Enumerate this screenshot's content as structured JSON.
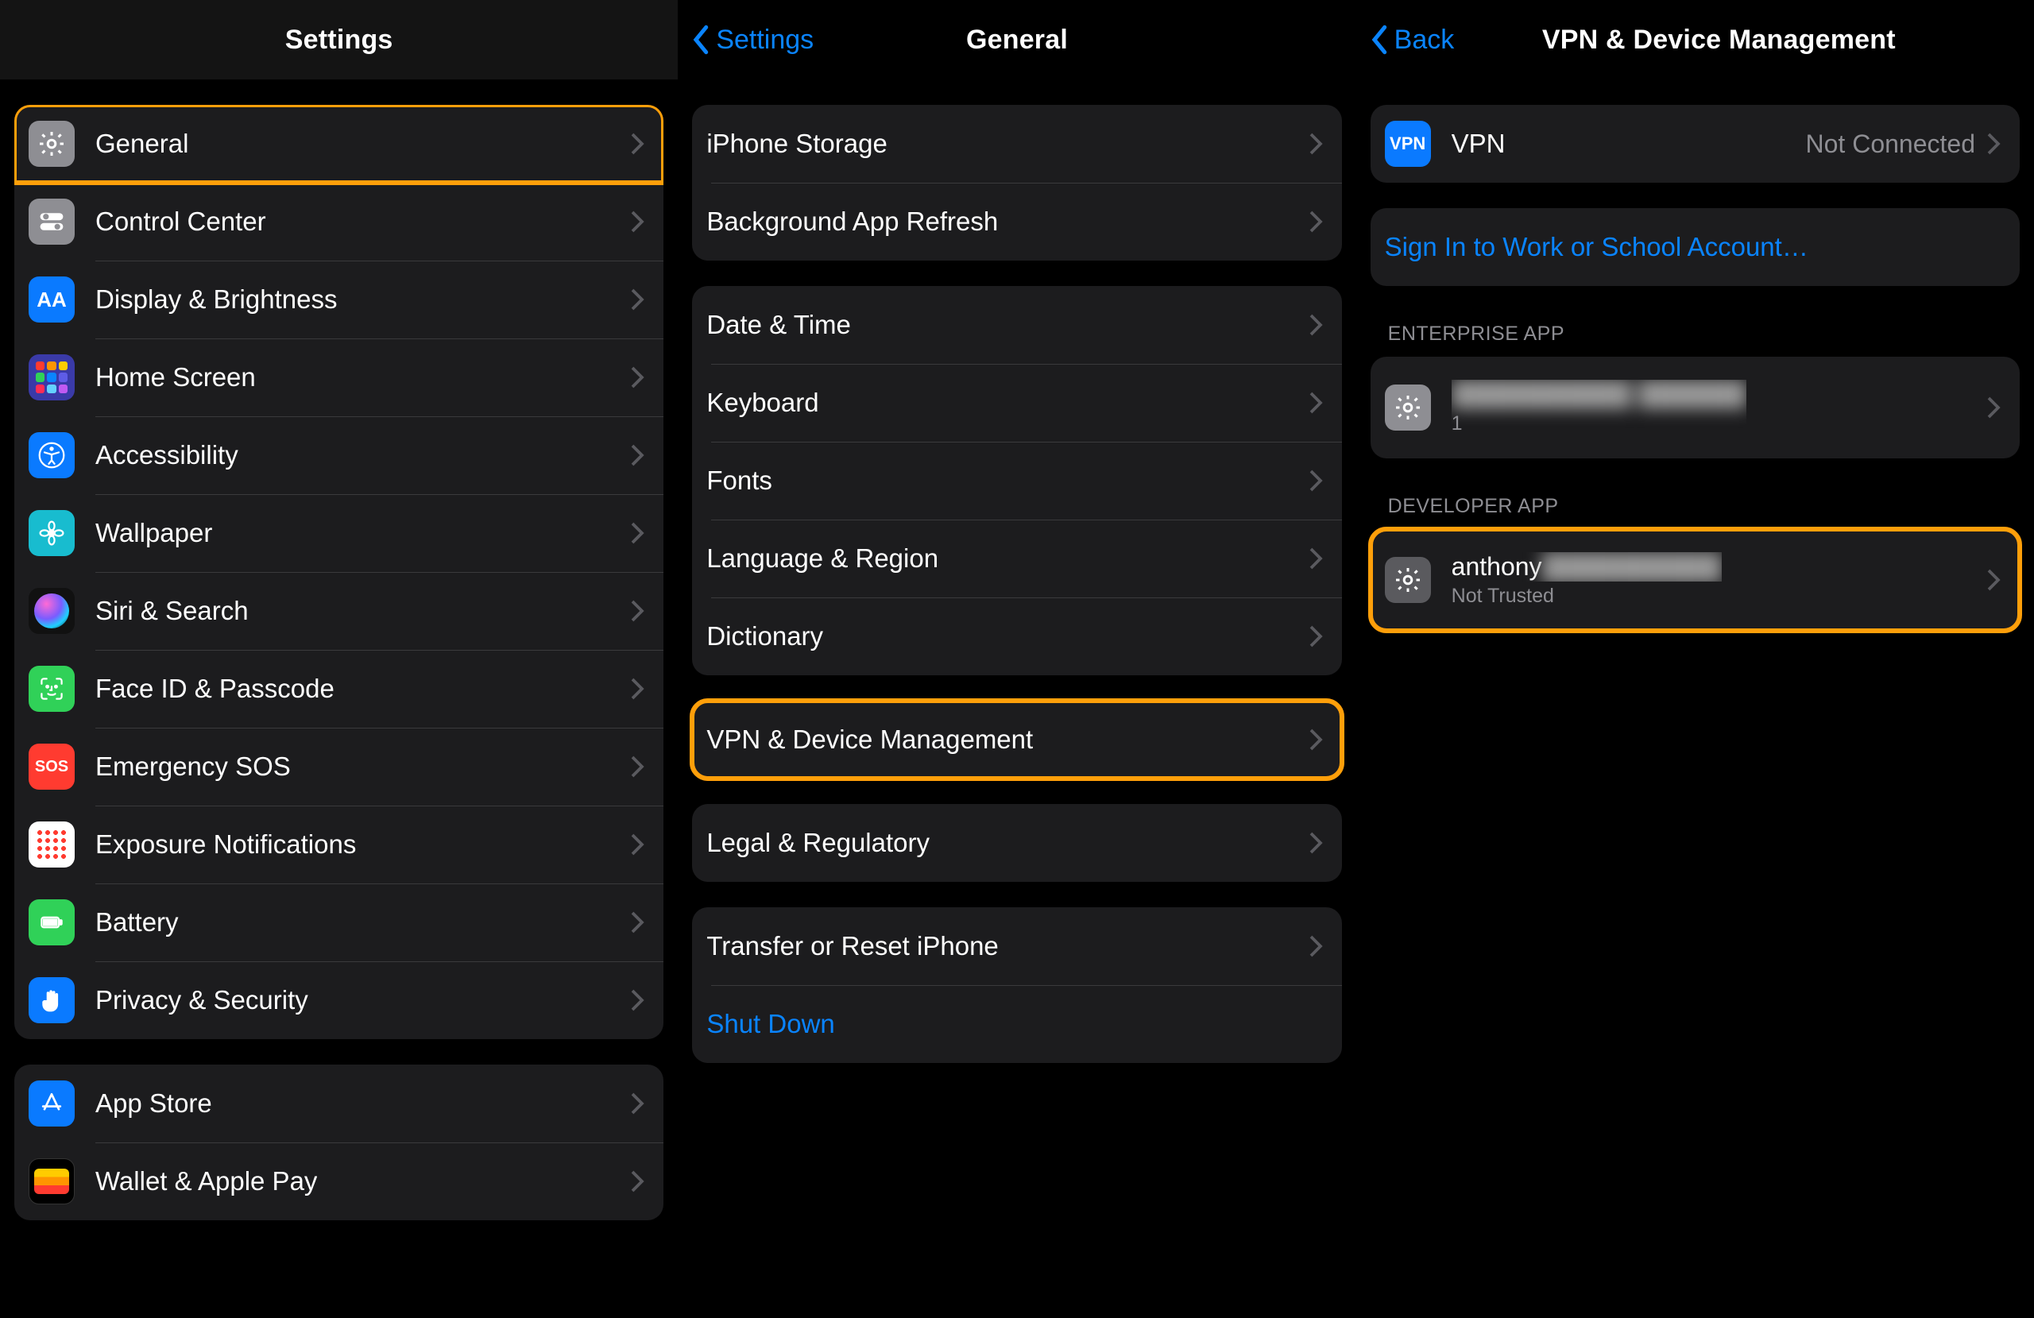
{
  "highlight_color": "#ff9f0a",
  "panel1": {
    "title": "Settings",
    "groups": [
      [
        {
          "key": "general",
          "label": "General",
          "icon": "gear-icon",
          "highlighted": true
        },
        {
          "key": "control-center",
          "label": "Control Center",
          "icon": "toggles-icon"
        },
        {
          "key": "display",
          "label": "Display & Brightness",
          "icon": "text-size-icon"
        },
        {
          "key": "home-screen",
          "label": "Home Screen",
          "icon": "app-grid-icon"
        },
        {
          "key": "accessibility",
          "label": "Accessibility",
          "icon": "accessibility-icon"
        },
        {
          "key": "wallpaper",
          "label": "Wallpaper",
          "icon": "flower-icon"
        },
        {
          "key": "siri",
          "label": "Siri & Search",
          "icon": "siri-icon"
        },
        {
          "key": "faceid",
          "label": "Face ID & Passcode",
          "icon": "faceid-icon"
        },
        {
          "key": "sos",
          "label": "Emergency SOS",
          "icon": "sos-icon"
        },
        {
          "key": "exposure",
          "label": "Exposure Notifications",
          "icon": "exposure-icon"
        },
        {
          "key": "battery",
          "label": "Battery",
          "icon": "battery-icon"
        },
        {
          "key": "privacy",
          "label": "Privacy & Security",
          "icon": "hand-icon"
        }
      ],
      [
        {
          "key": "app-store",
          "label": "App Store",
          "icon": "appstore-icon"
        },
        {
          "key": "wallet",
          "label": "Wallet & Apple Pay",
          "icon": "wallet-icon"
        }
      ]
    ]
  },
  "panel2": {
    "back_label": "Settings",
    "title": "General",
    "groups": [
      [
        {
          "key": "storage",
          "label": "iPhone Storage"
        },
        {
          "key": "bg-refresh",
          "label": "Background App Refresh"
        }
      ],
      [
        {
          "key": "date-time",
          "label": "Date & Time"
        },
        {
          "key": "keyboard",
          "label": "Keyboard"
        },
        {
          "key": "fonts",
          "label": "Fonts"
        },
        {
          "key": "language",
          "label": "Language & Region"
        },
        {
          "key": "dictionary",
          "label": "Dictionary"
        }
      ],
      [
        {
          "key": "vpn-dm",
          "label": "VPN & Device Management",
          "highlighted": true
        }
      ],
      [
        {
          "key": "legal",
          "label": "Legal & Regulatory"
        }
      ],
      [
        {
          "key": "transfer",
          "label": "Transfer or Reset iPhone"
        },
        {
          "key": "shutdown",
          "label": "Shut Down",
          "style": "blue",
          "no_chevron": true
        }
      ]
    ]
  },
  "panel3": {
    "back_label": "Back",
    "title": "VPN & Device Management",
    "vpn_row": {
      "icon_text": "VPN",
      "label": "VPN",
      "value": "Not Connected"
    },
    "signin_label": "Sign In to Work or School Account…",
    "sections": [
      {
        "header": "ENTERPRISE APP",
        "row": {
          "label_blurred": true,
          "label": "██████████ ██████",
          "sub": "1"
        }
      },
      {
        "header": "DEVELOPER APP",
        "row": {
          "label": "anthony",
          "label_suffix_blurred": "██████████",
          "sub": "Not Trusted",
          "highlighted": true
        }
      }
    ]
  }
}
